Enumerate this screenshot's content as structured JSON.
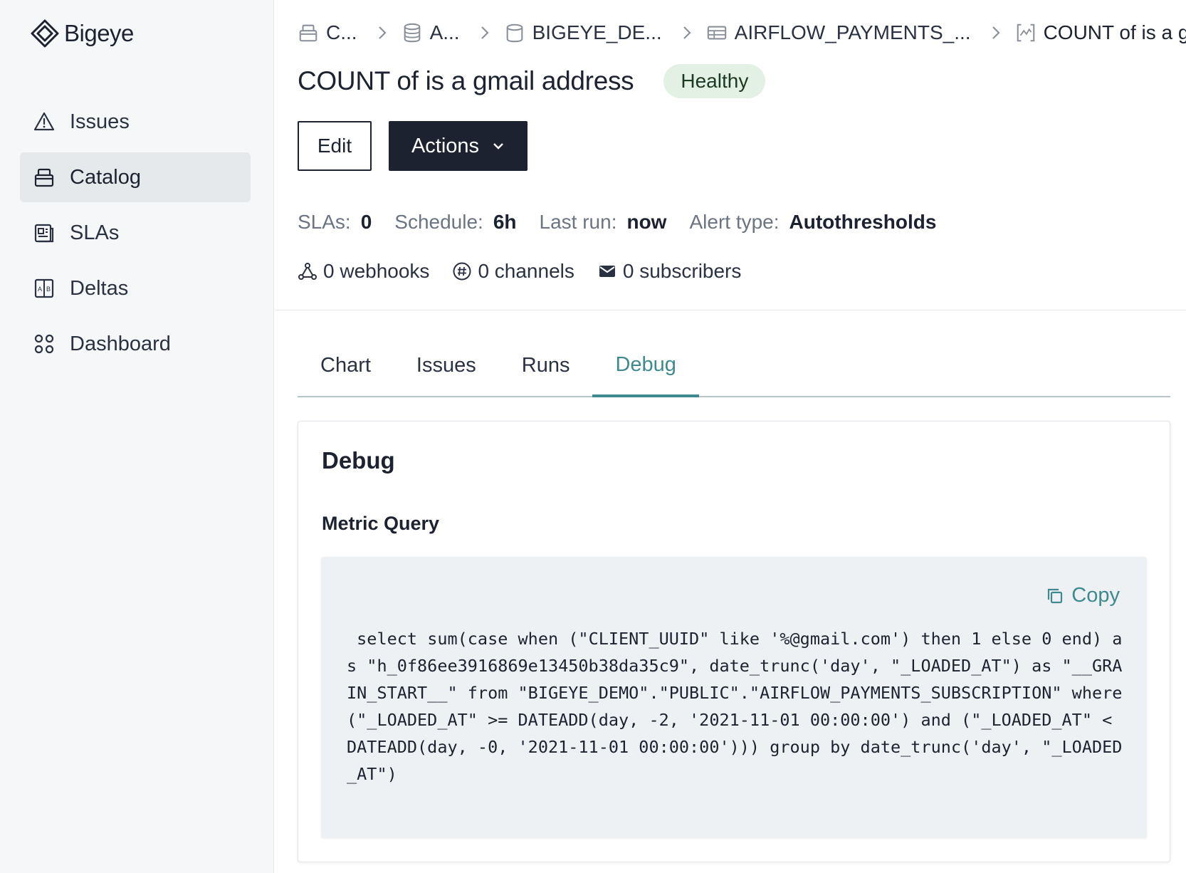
{
  "app": {
    "name": "Bigeye"
  },
  "sidebar": {
    "items": [
      {
        "label": "Issues",
        "icon": "warning-triangle-icon",
        "active": false
      },
      {
        "label": "Catalog",
        "icon": "catalog-icon",
        "active": true
      },
      {
        "label": "SLAs",
        "icon": "sla-icon",
        "active": false
      },
      {
        "label": "Deltas",
        "icon": "deltas-icon",
        "active": false
      },
      {
        "label": "Dashboard",
        "icon": "dashboard-grid-icon",
        "active": false
      }
    ]
  },
  "breadcrumb": [
    {
      "label": "C...",
      "icon": "catalog-icon"
    },
    {
      "label": "A...",
      "icon": "database-icon"
    },
    {
      "label": "BIGEYE_DE...",
      "icon": "schema-icon"
    },
    {
      "label": "AIRFLOW_PAYMENTS_...",
      "icon": "table-icon"
    },
    {
      "label": "COUNT of is a g...",
      "icon": "metric-icon"
    }
  ],
  "header": {
    "title": "COUNT of is a gmail address",
    "status": "Healthy",
    "edit_label": "Edit",
    "actions_label": "Actions"
  },
  "meta": {
    "slas_label": "SLAs:",
    "slas_value": "0",
    "schedule_label": "Schedule:",
    "schedule_value": "6h",
    "last_run_label": "Last run:",
    "last_run_value": "now",
    "alert_type_label": "Alert type:",
    "alert_type_value": "Autothresholds"
  },
  "notifications": {
    "webhooks": "0 webhooks",
    "channels": "0 channels",
    "subscribers": "0 subscribers"
  },
  "tabs": [
    {
      "label": "Chart",
      "active": false
    },
    {
      "label": "Issues",
      "active": false
    },
    {
      "label": "Runs",
      "active": false
    },
    {
      "label": "Debug",
      "active": true
    }
  ],
  "debug": {
    "title": "Debug",
    "section_title": "Metric Query",
    "copy_label": "Copy",
    "query": " select sum(case when (\"CLIENT_UUID\" like '%@gmail.com') then 1 else 0 end) as \"h_0f86ee3916869e13450b38da35c9\", date_trunc('day', \"_LOADED_AT\") as \"__GRAIN_START__\" from \"BIGEYE_DEMO\".\"PUBLIC\".\"AIRFLOW_PAYMENTS_SUBSCRIPTION\" where (\"_LOADED_AT\" >= DATEADD(day, -2, '2021-11-01 00:00:00') and (\"_LOADED_AT\" < DATEADD(day, -0, '2021-11-01 00:00:00'))) group by date_trunc('day', \"_LOADED_AT\")"
  },
  "colors": {
    "accent": "#3e8a8e",
    "primary_dark": "#1c2230",
    "healthy_bg": "#e3f1e4"
  }
}
